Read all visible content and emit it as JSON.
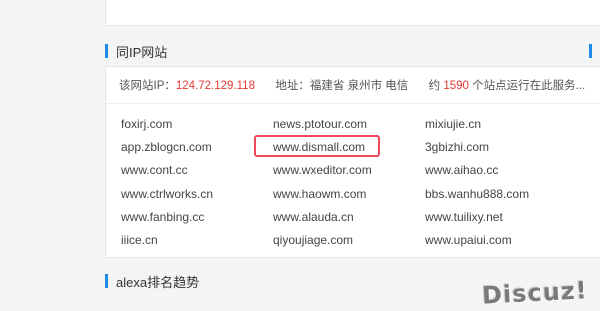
{
  "sections": {
    "ip": {
      "title": "同IP网站"
    },
    "alexa": {
      "title": "alexa排名趋势"
    }
  },
  "info": {
    "ip_label": "该网站IP：",
    "ip_value": "124.72.129.118",
    "address_label": "地址：",
    "address_value": "福建省 泉州市 电信",
    "count_prefix": "约",
    "count_value": "1590",
    "count_suffix": "个站点运行在此服务..."
  },
  "sites": [
    "foxirj.com",
    "news.ptotour.com",
    "mixiujie.cn",
    "app.zblogcn.com",
    "www.dismall.com",
    "3gbizhi.com",
    "www.cont.cc",
    "www.wxeditor.com",
    "www.aihao.cc",
    "www.ctrlworks.cn",
    "www.haowm.com",
    "bbs.wanhu888.com",
    "www.fanbing.cc",
    "www.alauda.cn",
    "www.tuilixy.net",
    "iiice.cn",
    "qiyoujiage.com",
    "www.upaiui.com"
  ],
  "highlighted_site": "www.dismall.com",
  "watermark": "Discuz!",
  "colors": {
    "accent": "#1e88e5",
    "red": "#e53935",
    "highlight_border": "#f0485a"
  }
}
